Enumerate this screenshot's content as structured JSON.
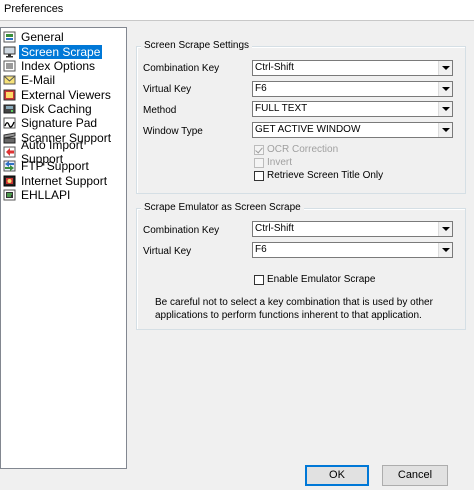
{
  "window": {
    "title": "Preferences"
  },
  "tree": {
    "items": [
      {
        "label": "General",
        "icon": "gear-icon",
        "selected": false
      },
      {
        "label": "Screen Scrape",
        "icon": "monitor-icon",
        "selected": true
      },
      {
        "label": "Index Options",
        "icon": "index-icon",
        "selected": false
      },
      {
        "label": "E-Mail",
        "icon": "email-icon",
        "selected": false
      },
      {
        "label": "External Viewers",
        "icon": "viewer-icon",
        "selected": false
      },
      {
        "label": "Disk Caching",
        "icon": "disk-icon",
        "selected": false
      },
      {
        "label": "Signature Pad",
        "icon": "signature-icon",
        "selected": false
      },
      {
        "label": "Scanner Support",
        "icon": "scanner-icon",
        "selected": false
      },
      {
        "label": "Auto Import Support",
        "icon": "import-icon",
        "selected": false
      },
      {
        "label": "FTP Support",
        "icon": "ftp-icon",
        "selected": false
      },
      {
        "label": "Internet Support",
        "icon": "internet-icon",
        "selected": false
      },
      {
        "label": "EHLLAPI",
        "icon": "ehllapi-icon",
        "selected": false
      }
    ]
  },
  "settings": {
    "title": "Screen Scrape Settings",
    "combination_key": {
      "label": "Combination Key",
      "value": "Ctrl-Shift"
    },
    "virtual_key": {
      "label": "Virtual Key",
      "value": "F6"
    },
    "method": {
      "label": "Method",
      "value": "FULL TEXT"
    },
    "window_type": {
      "label": "Window Type",
      "value": "GET ACTIVE WINDOW"
    },
    "ocr_correction": {
      "label": "OCR Correction",
      "checked": true,
      "enabled": false
    },
    "invert": {
      "label": "Invert",
      "checked": false,
      "enabled": false
    },
    "retrieve_title": {
      "label": "Retrieve Screen Title Only",
      "checked": false,
      "enabled": true
    }
  },
  "emulator": {
    "title": "Scrape Emulator as Screen Scrape",
    "combination_key": {
      "label": "Combination Key",
      "value": "Ctrl-Shift"
    },
    "virtual_key": {
      "label": "Virtual Key",
      "value": "F6"
    },
    "enable": {
      "label": "Enable Emulator Scrape",
      "checked": false
    },
    "note_line1": "Be careful not to select a key combination that is used by other",
    "note_line2": "applications to perform functions inherent to that application."
  },
  "buttons": {
    "ok": "OK",
    "cancel": "Cancel"
  },
  "colors": {
    "selection": "#0078d7",
    "background": "#f0f0f0"
  }
}
